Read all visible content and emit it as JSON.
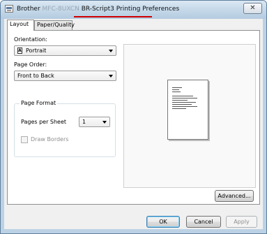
{
  "window": {
    "title_prefix": "Brother",
    "title_model": "MFC-8UXCN",
    "title_driver": "BR-Script3",
    "title_rest": "Printing Preferences"
  },
  "tabs": [
    {
      "label": "Layout",
      "active": true
    },
    {
      "label": "Paper/Quality",
      "active": false
    }
  ],
  "layout": {
    "orientation_label": "Orientation:",
    "orientation_value": "Portrait",
    "page_order_label": "Page Order:",
    "page_order_value": "Front to Back",
    "page_format_title": "Page Format",
    "pages_per_sheet_label": "Pages per Sheet",
    "pages_per_sheet_value": "1",
    "draw_borders_label": "Draw Borders",
    "draw_borders_checked": false,
    "draw_borders_enabled": false
  },
  "buttons": {
    "advanced": "Advanced...",
    "ok": "OK",
    "cancel": "Cancel",
    "apply": "Apply"
  },
  "icons": {
    "close": "close-icon",
    "orientation": "portrait-page-icon"
  },
  "colors": {
    "title_underline": "#d00000"
  }
}
